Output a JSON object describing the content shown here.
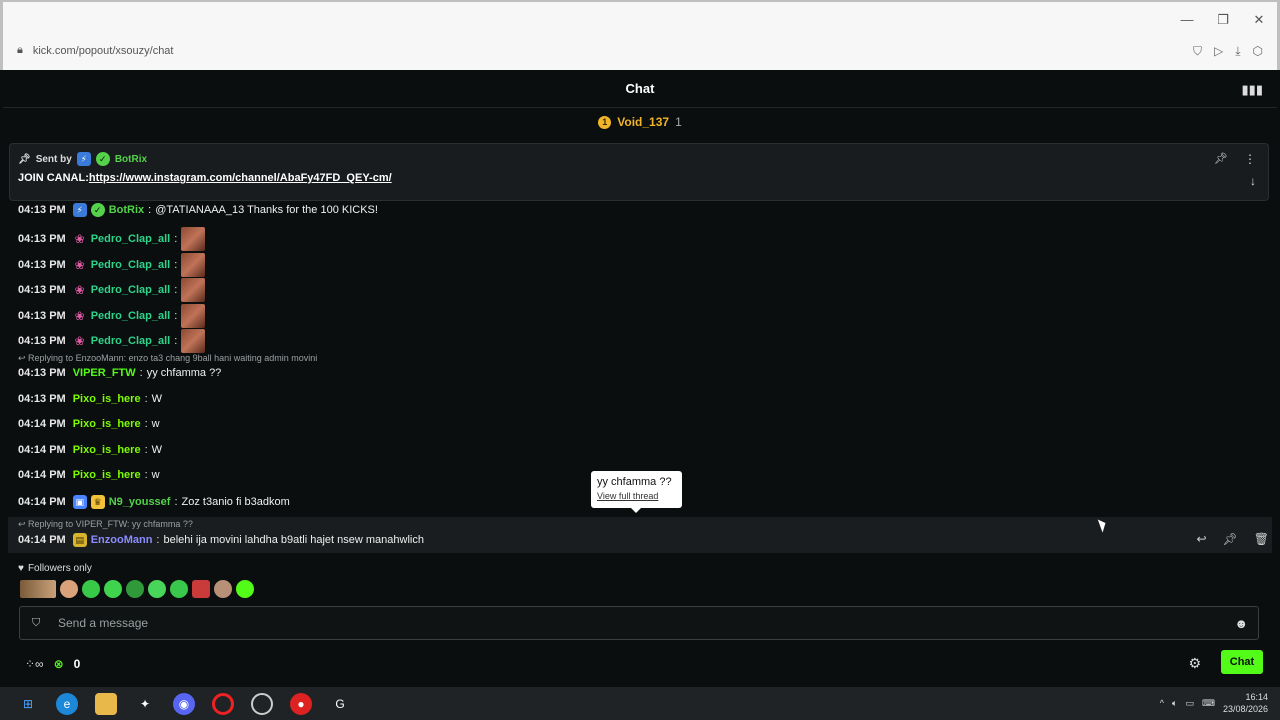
{
  "browser": {
    "url": "kick.com/popout/xsouzy/chat",
    "window_controls": [
      "minimize-icon",
      "restore-icon",
      "close-icon"
    ]
  },
  "chat": {
    "title": "Chat",
    "leaderboard": {
      "rank": "1",
      "name": "Void_137",
      "count": "1"
    },
    "pinned": {
      "sent_by_label": "Sent by",
      "sender": "BotRix",
      "prefix": "JOIN CANAL:",
      "link": "https://www.instagram.com/channel/AbaFy47FD_QEY-cm/"
    },
    "messages": [
      {
        "time": "04:13 PM",
        "user": "BotRix",
        "color": "#53d24a",
        "text": "@TATIANAAA_13 Thanks for the 100 KICKS!"
      },
      {
        "time": "04:13 PM",
        "user": "Pedro_Clap_all",
        "color": "#2fd38a",
        "text": ""
      },
      {
        "time": "04:13 PM",
        "user": "Pedro_Clap_all",
        "color": "#2fd38a",
        "text": ""
      },
      {
        "time": "04:13 PM",
        "user": "Pedro_Clap_all",
        "color": "#2fd38a",
        "text": ""
      },
      {
        "time": "04:13 PM",
        "user": "Pedro_Clap_all",
        "color": "#2fd38a",
        "text": ""
      },
      {
        "time": "04:13 PM",
        "user": "Pedro_Clap_all",
        "color": "#2fd38a",
        "text": ""
      },
      {
        "time": "04:13 PM",
        "user": "VIPER_FTW",
        "color": "#53fc18",
        "text": "yy chfamma ??"
      },
      {
        "time": "04:13 PM",
        "user": "Pixo_is_here",
        "color": "#7cfc00",
        "text": "W"
      },
      {
        "time": "04:14 PM",
        "user": "Pixo_is_here",
        "color": "#7cfc00",
        "text": "w"
      },
      {
        "time": "04:14 PM",
        "user": "Pixo_is_here",
        "color": "#7cfc00",
        "text": "W"
      },
      {
        "time": "04:14 PM",
        "user": "Pixo_is_here",
        "color": "#7cfc00",
        "text": "w"
      },
      {
        "time": "04:14 PM",
        "user": "N9_youssef",
        "color": "#53d24a",
        "text": "Zoz t3anio fi b3adkom"
      },
      {
        "time": "04:14 PM",
        "user": "EnzooMann",
        "color": "#8c8cff",
        "text": "belehi ija movini lahdha b9atli hajet nsew manahwlich"
      }
    ],
    "replies": [
      "Replying to EnzooMann: enzo ta3 chang 9ball hani waiting admin movini",
      "Replying to VIPER_FTW: yy chfamma ??"
    ],
    "tooltip": {
      "text": "yy chfamma ??",
      "link": "View full thread"
    },
    "followers_label": "Followers only",
    "input_placeholder": "Send a message",
    "kick_count": "0",
    "chat_button": "Chat"
  },
  "taskbar": {
    "time": "16:14",
    "date": "23/08/2026"
  }
}
